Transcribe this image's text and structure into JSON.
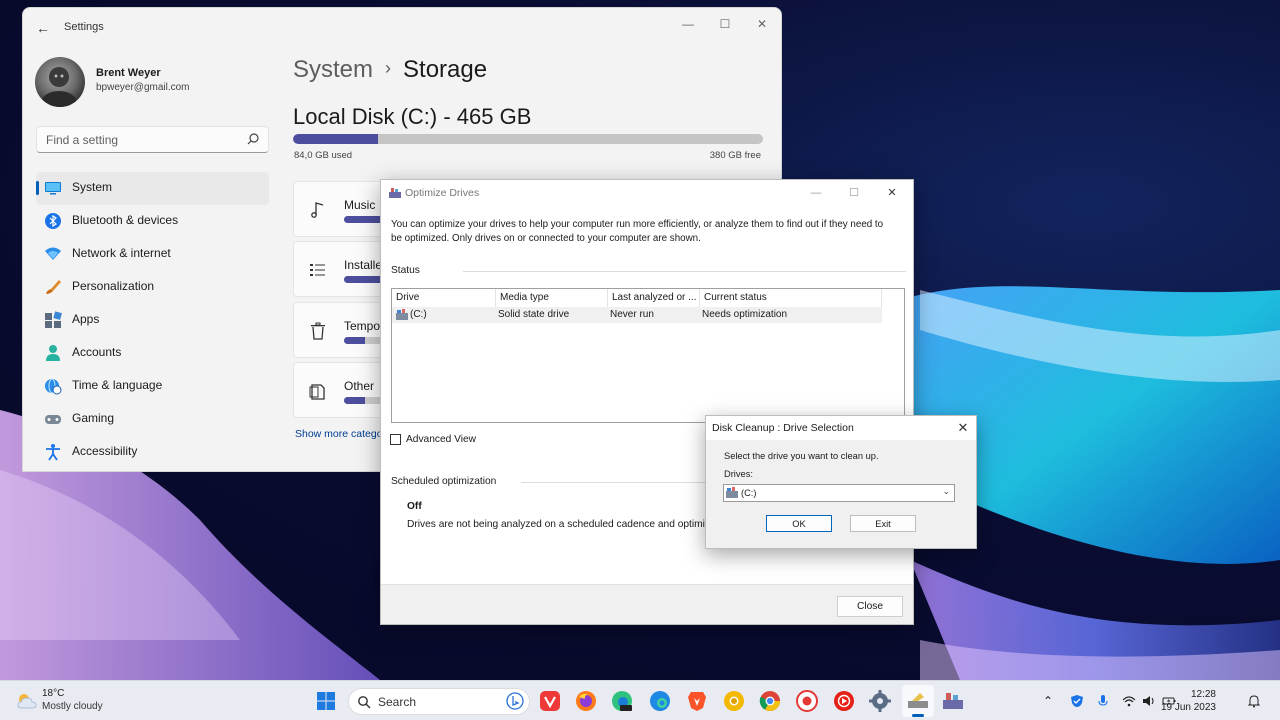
{
  "settings": {
    "window_title": "Settings",
    "profile": {
      "name": "Brent Weyer",
      "email": "bpweyer@gmail.com"
    },
    "search_placeholder": "Find a setting",
    "nav": [
      {
        "label": "System",
        "icon": "system-icon",
        "active": true
      },
      {
        "label": "Bluetooth & devices",
        "icon": "bluetooth-icon"
      },
      {
        "label": "Network & internet",
        "icon": "wifi-icon"
      },
      {
        "label": "Personalization",
        "icon": "brush-icon"
      },
      {
        "label": "Apps",
        "icon": "apps-icon"
      },
      {
        "label": "Accounts",
        "icon": "person-icon"
      },
      {
        "label": "Time & language",
        "icon": "globe-clock-icon"
      },
      {
        "label": "Gaming",
        "icon": "gamepad-icon"
      },
      {
        "label": "Accessibility",
        "icon": "accessibility-icon"
      }
    ],
    "breadcrumb": {
      "parent": "System",
      "separator": "›",
      "current": "Storage"
    },
    "disk": {
      "title": "Local Disk (C:) - 465 GB",
      "used_label": "84,0 GB used",
      "free_label": "380 GB free",
      "used_fraction": 0.18
    },
    "categories": [
      {
        "name": "Music",
        "icon": "music-note-icon",
        "fraction": 0.2
      },
      {
        "name": "Installed",
        "icon": "list-icon",
        "fraction": 0.15
      },
      {
        "name": "Tempor",
        "icon": "trash-icon",
        "fraction": 0.05
      },
      {
        "name": "Other",
        "icon": "file-icon",
        "fraction": 0.05
      }
    ],
    "show_more": "Show more categor"
  },
  "optimize": {
    "title": "Optimize Drives",
    "description": "You can optimize your drives to help your computer run more efficiently, or analyze them to find out if they need to be optimized. Only drives on or connected to your computer are shown.",
    "status_label": "Status",
    "columns": [
      "Drive",
      "Media type",
      "Last analyzed or ...",
      "Current status"
    ],
    "rows": [
      {
        "drive": "(C:)",
        "media": "Solid state drive",
        "last": "Never run",
        "status": "Needs optimization"
      }
    ],
    "advanced_view": "Advanced View",
    "scheduled_label": "Scheduled optimization",
    "scheduled_status": "Off",
    "scheduled_desc": "Drives are not being analyzed on a scheduled cadence and optimize",
    "close_label": "Close"
  },
  "cleanup": {
    "title": "Disk Cleanup : Drive Selection",
    "prompt": "Select the drive you want to clean up.",
    "drives_label": "Drives:",
    "selected_drive": "(C:)",
    "ok_label": "OK",
    "exit_label": "Exit"
  },
  "taskbar": {
    "weather_temp": "18°C",
    "weather_desc": "Mostly cloudy",
    "search_label": "Search",
    "time": "12:28",
    "date": "19 Jun 2023"
  },
  "colors": {
    "accent": "#005fb8",
    "storage_bar": "#4d4f9e"
  }
}
